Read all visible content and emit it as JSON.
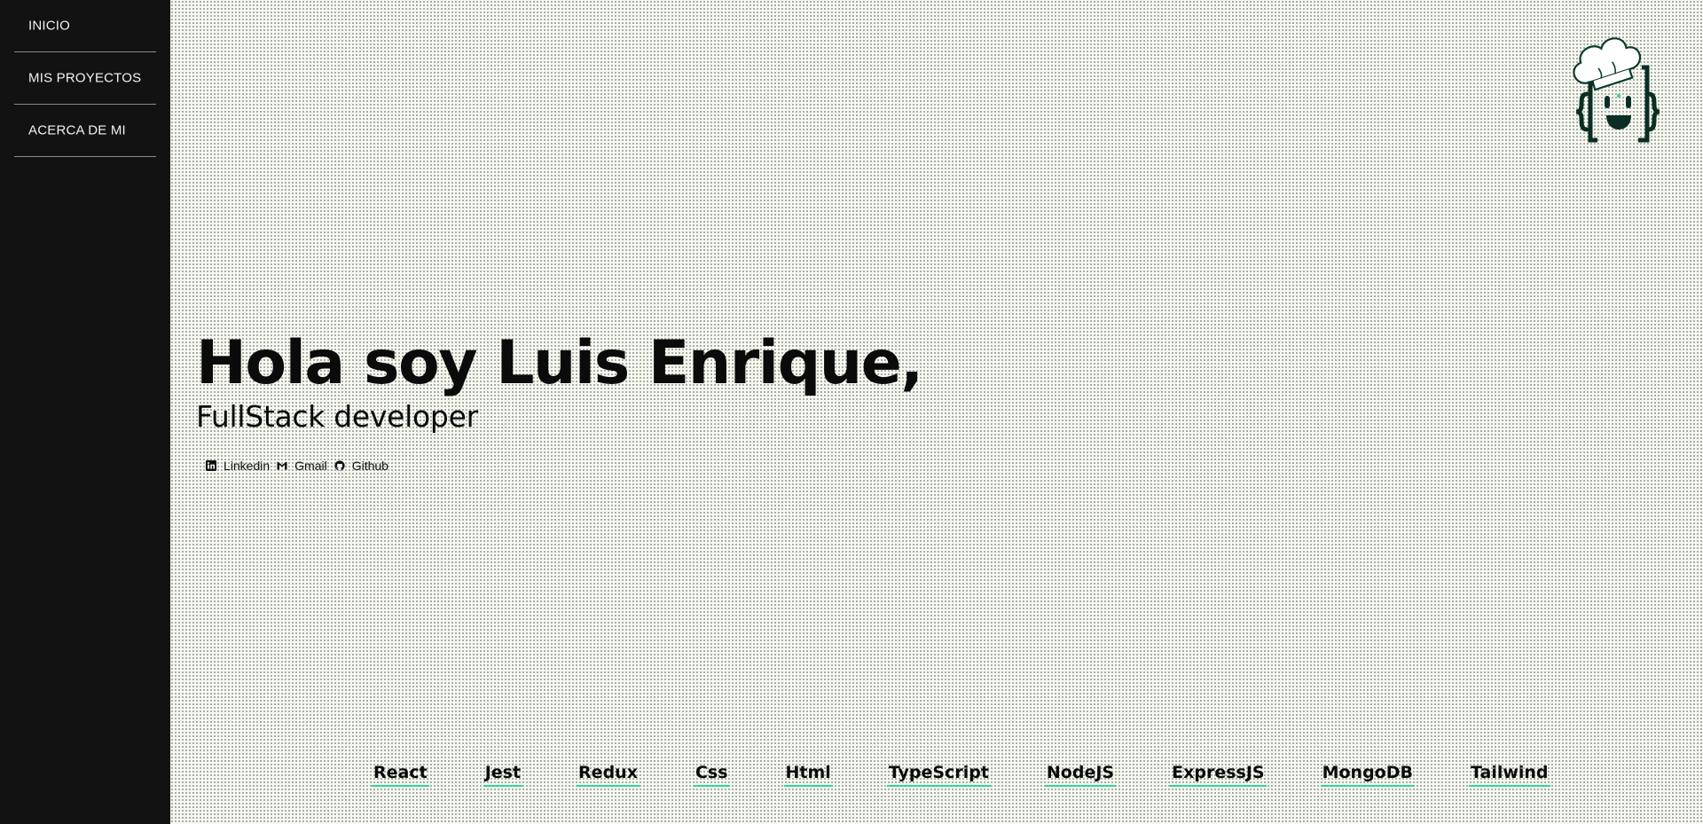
{
  "sidebar": {
    "items": [
      {
        "label": "INICIO"
      },
      {
        "label": "MIS PROYECTOS"
      },
      {
        "label": "ACERCA DE MI"
      }
    ]
  },
  "logo": {
    "icon": "chef-hat-code-braces-logo",
    "accent": "#2ed69a"
  },
  "hero": {
    "title": "Hola soy Luis Enrique,",
    "subtitle": "FullStack developer"
  },
  "social": [
    {
      "icon": "linkedin-icon",
      "label": "Linkedin"
    },
    {
      "icon": "gmail-icon",
      "label": "Gmail"
    },
    {
      "icon": "github-icon",
      "label": "Github"
    }
  ],
  "technologies": [
    "React",
    "Jest",
    "Redux",
    "Css",
    "Html",
    "TypeScript",
    "NodeJS",
    "ExpressJS",
    "MongoDB",
    "Tailwind"
  ],
  "colors": {
    "sidebar_bg": "#121212",
    "page_bg": "#f7f9f2",
    "underline": "#2ed69a",
    "text": "#0b0b0b"
  }
}
